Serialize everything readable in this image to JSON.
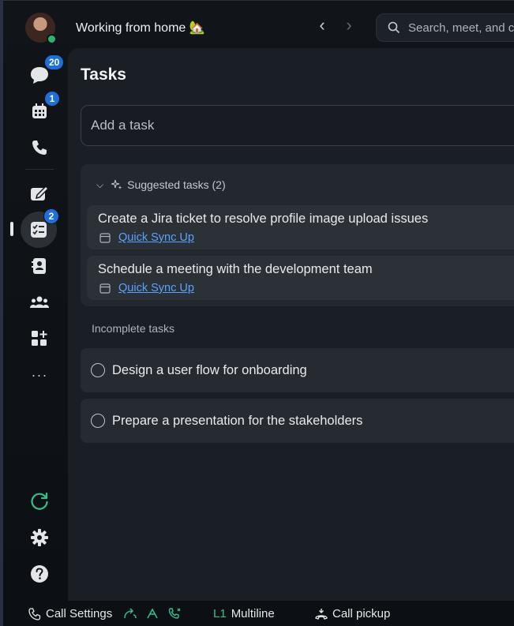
{
  "header": {
    "status_text": "Working from home 🏡",
    "search_placeholder": "Search, meet, and call",
    "nav_back": "‹",
    "nav_forward": "›"
  },
  "rail": {
    "items": [
      {
        "name": "messaging",
        "icon": "chat-icon",
        "badge": "20"
      },
      {
        "name": "calendar",
        "icon": "calendar-icon",
        "badge": "1"
      },
      {
        "name": "calling",
        "icon": "phone-icon",
        "badge": ""
      },
      {
        "name": "whiteboard",
        "icon": "edit-icon",
        "badge": ""
      },
      {
        "name": "tasks",
        "icon": "tasks-icon",
        "badge": "2",
        "active": true
      },
      {
        "name": "contacts",
        "icon": "contacts-icon",
        "badge": ""
      },
      {
        "name": "teams",
        "icon": "teams-icon",
        "badge": ""
      },
      {
        "name": "apps",
        "icon": "apps-add-icon",
        "badge": ""
      },
      {
        "name": "more",
        "icon": "more-icon",
        "label": "···"
      }
    ],
    "bottom": [
      {
        "name": "refresh",
        "icon": "refresh-icon"
      },
      {
        "name": "settings",
        "icon": "gear-icon"
      },
      {
        "name": "help",
        "icon": "help-icon"
      }
    ]
  },
  "main": {
    "title": "Tasks",
    "add_task_placeholder": "Add a task",
    "suggested": {
      "heading": "Suggested tasks (2)",
      "items": [
        {
          "text": "Create a Jira ticket to resolve profile image upload issues",
          "source": "Quick Sync Up"
        },
        {
          "text": "Schedule a meeting with the development team",
          "source": "Quick Sync Up"
        }
      ]
    },
    "incomplete": {
      "heading": "Incomplete tasks",
      "items": [
        {
          "text": "Design a user flow for onboarding"
        },
        {
          "text": "Prepare a presentation for the stakeholders"
        }
      ]
    }
  },
  "footer": {
    "call_settings": "Call Settings",
    "line_id": "L1",
    "line_label": "Multiline",
    "call_pickup": "Call pickup"
  },
  "colors": {
    "accent_blue": "#1f6fd8",
    "link": "#5aa2ff",
    "presence_green": "#2fb36f",
    "refresh_green": "#35c08a"
  }
}
